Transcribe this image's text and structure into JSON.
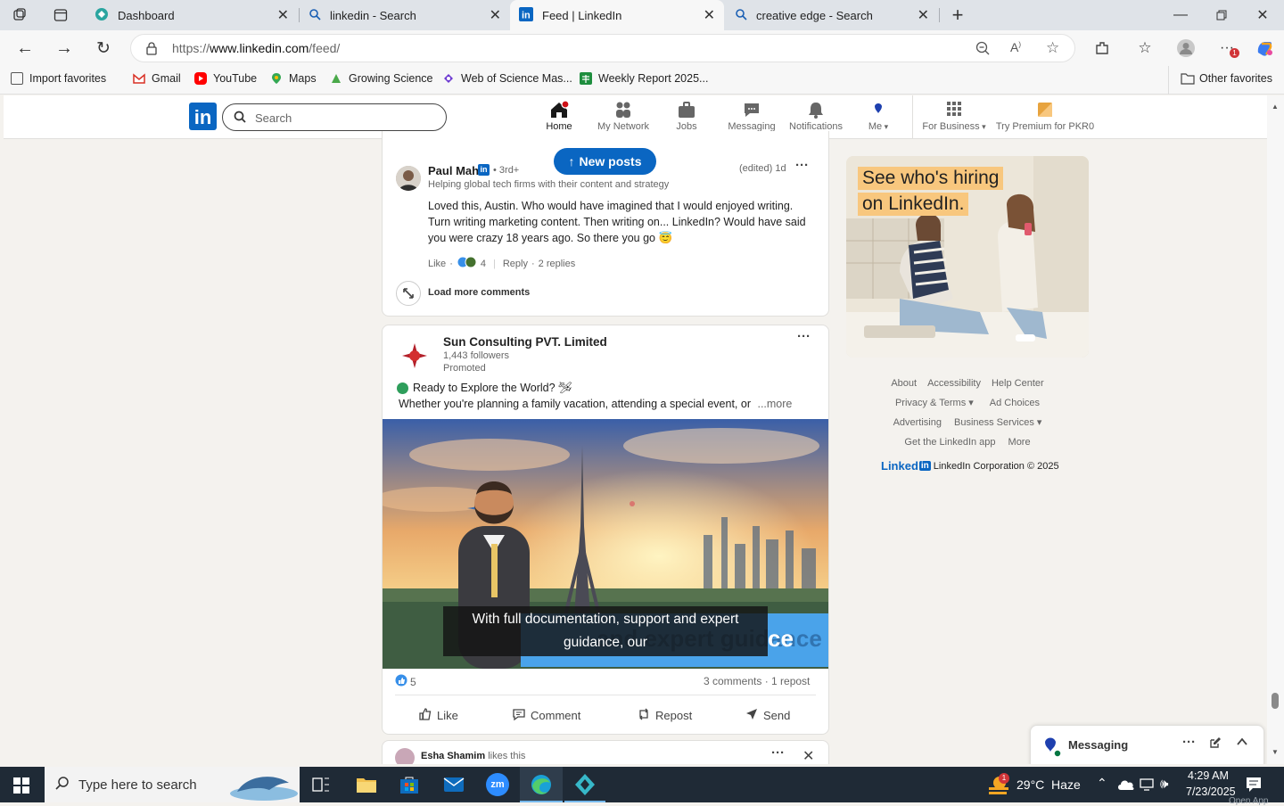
{
  "browser": {
    "tabs": [
      {
        "title": "Dashboard",
        "icon": "dashboard-icon"
      },
      {
        "title": "linkedin - Search",
        "icon": "search-icon"
      },
      {
        "title": "Feed | LinkedIn",
        "icon": "linkedin-icon"
      },
      {
        "title": "creative edge - Search",
        "icon": "search-icon"
      }
    ],
    "url_prefix": "https://",
    "url_host": "www.linkedin.com",
    "url_path": "/feed/",
    "favorites": [
      {
        "label": "Import favorites",
        "icon": "import-icon"
      },
      {
        "label": "Gmail",
        "icon": "gmail-icon"
      },
      {
        "label": "YouTube",
        "icon": "youtube-icon"
      },
      {
        "label": "Maps",
        "icon": "maps-icon"
      },
      {
        "label": "Growing Science",
        "icon": "growing-science-icon"
      },
      {
        "label": "Web of Science Mas...",
        "icon": "web-of-science-icon"
      },
      {
        "label": "Weekly Report 2025...",
        "icon": "sheet-icon"
      }
    ],
    "other_favorites": "Other favorites",
    "extension_badge": "1"
  },
  "linkedin": {
    "logo": "in",
    "search_placeholder": "Search",
    "nav": [
      {
        "label": "Home",
        "icon": "home-icon"
      },
      {
        "label": "My Network",
        "icon": "network-icon"
      },
      {
        "label": "Jobs",
        "icon": "jobs-icon"
      },
      {
        "label": "Messaging",
        "icon": "messaging-icon"
      },
      {
        "label": "Notifications",
        "icon": "notifications-icon"
      },
      {
        "label": "Me",
        "icon": "me-avatar"
      },
      {
        "label": "For Business",
        "icon": "grid-icon"
      },
      {
        "label": "Try Premium for PKR0",
        "icon": "premium-icon"
      }
    ],
    "new_posts": "New posts"
  },
  "comment": {
    "author": "Paul Mah",
    "degree": "• 3rd+",
    "headline": "Helping global tech firms with their content and strategy",
    "meta": "(edited) 1d",
    "text": "Loved this, Austin. Who would have imagined that I would enjoyed writing. Turn writing marketing content. Then writing on... LinkedIn? Would have said you were crazy 18 years ago. So there you go 😇",
    "like": "Like",
    "reaction_count": "4",
    "reply": "Reply",
    "replies": "2 replies",
    "load_more": "Load more comments"
  },
  "post": {
    "company": "Sun Consulting PVT. Limited",
    "followers": "1,443 followers",
    "promoted": "Promoted",
    "line1": "Ready to Explore the World? 🛩",
    "line2": "Whether you're planning a family vacation, attending a special event, or",
    "more": "...more",
    "caption": "With full documentation, support and expert guidance, our",
    "banner_text": "and expert guidance",
    "reactions": "5",
    "stats": "3 comments · 1 repost",
    "actions": [
      "Like",
      "Comment",
      "Repost",
      "Send"
    ]
  },
  "next_post": {
    "name": "Esha Shamim",
    "suffix": "likes this"
  },
  "ad": {
    "headline_1": "See who's hiring",
    "headline_2": "on LinkedIn."
  },
  "footer": {
    "row1": [
      "About",
      "Accessibility",
      "Help Center"
    ],
    "row2": [
      "Privacy & Terms ▾",
      "Ad Choices"
    ],
    "row3": [
      "Advertising",
      "Business Services ▾"
    ],
    "row4": [
      "Get the LinkedIn app",
      "More"
    ],
    "brand": "Linked",
    "copyright": "LinkedIn Corporation © 2025"
  },
  "messaging": {
    "label": "Messaging"
  },
  "taskbar": {
    "search_placeholder": "Type here to search",
    "weather": "29°C  Haze",
    "time": "4:29 AM",
    "date": "7/23/2025",
    "weather_badge": "1",
    "partial_text": "Open App"
  },
  "colors": {
    "linkedin_blue": "#0a66c2",
    "accent_red": "#cc1016",
    "page_bg": "#f4f2ee"
  }
}
